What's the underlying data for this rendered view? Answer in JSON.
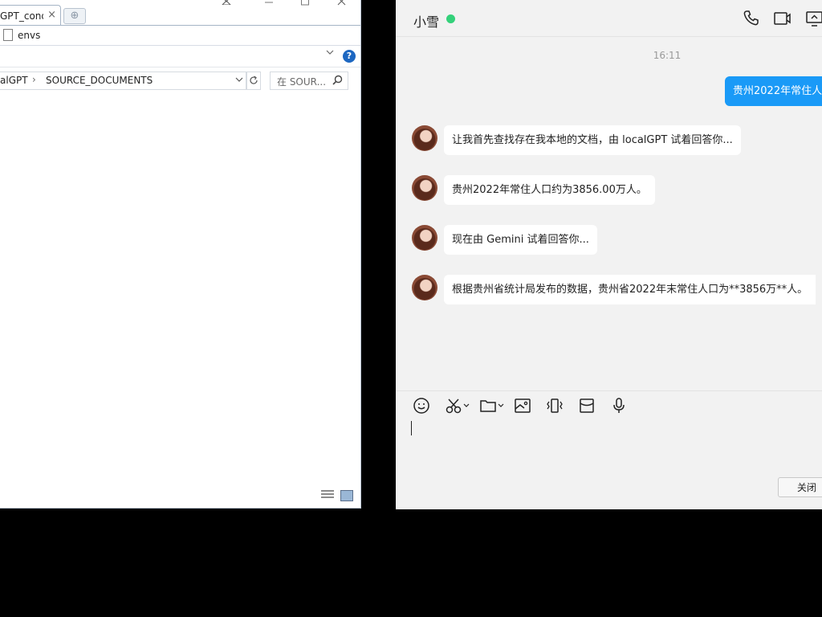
{
  "explorer": {
    "tab_title": "GPT_conda",
    "tab_close": "×",
    "new_tab": "⊕",
    "favorite": "envs",
    "address": {
      "seg1": "alGPT",
      "sep": "›",
      "seg2": "SOURCE_DOCUMENTS"
    },
    "search_placeholder": "在 SOUR...",
    "help": "?"
  },
  "chat": {
    "contact_name": "小雪",
    "timestamp": "16:11",
    "outgoing": "贵州2022年常住人",
    "messages": [
      {
        "text": "让我首先查找存在我本地的文档，由 localGPT 试着回答你..."
      },
      {
        "text": " 贵州2022年常住人口约为3856.00万人。"
      },
      {
        "text": "现在由 Gemini 试着回答你..."
      },
      {
        "text": "根据贵州省统计局发布的数据，贵州省2022年末常住人口为**3856万**人。"
      }
    ],
    "close_label": "关闭",
    "colors": {
      "accent": "#1a9af7",
      "online": "#34d17a"
    }
  }
}
